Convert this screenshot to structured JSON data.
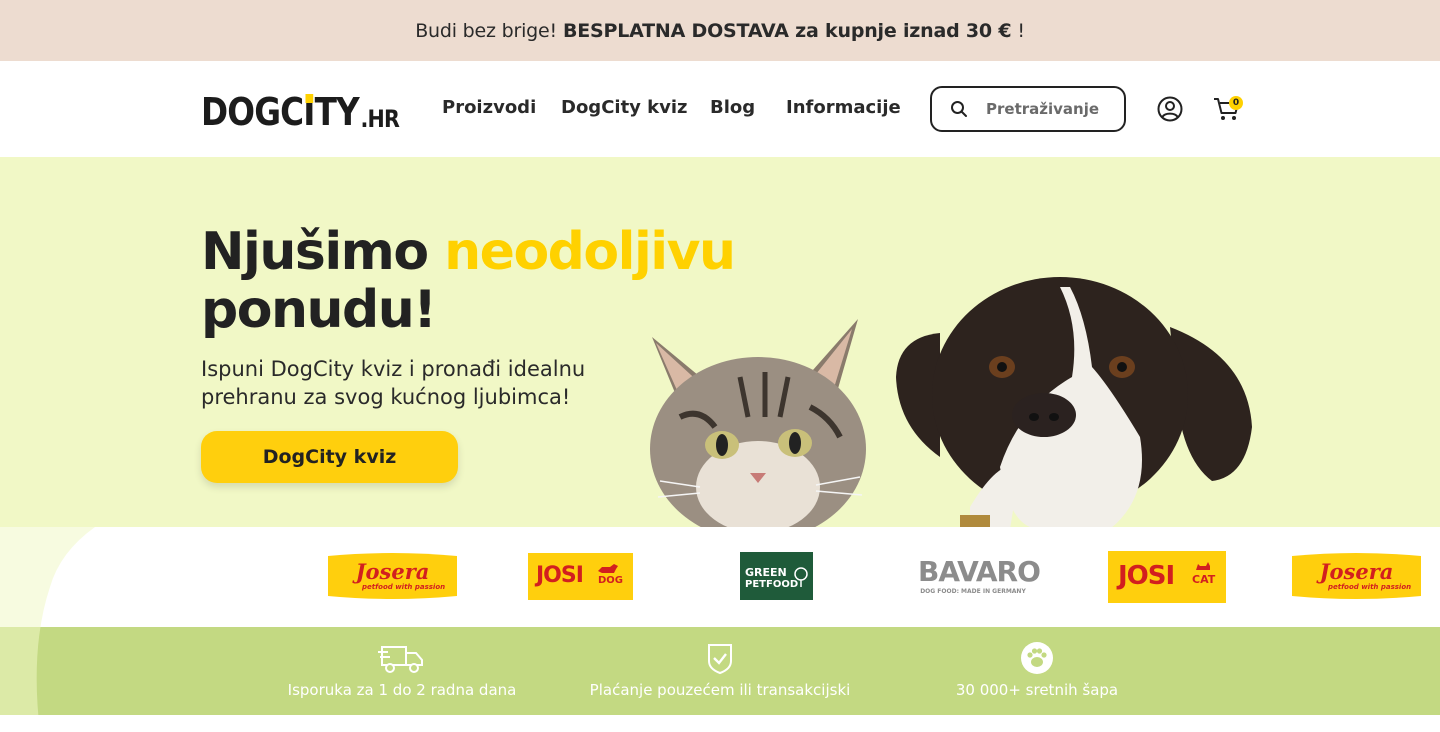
{
  "topbar": {
    "text": "Budi bez brige!",
    "bold": "BESPLATNA DOSTAVA za kupnje iznad 30 €",
    "tail": "!"
  },
  "header": {
    "logo": {
      "main_a": "DOGC",
      "main_i": "I",
      "main_b": "TY",
      "suffix": ".HR"
    },
    "nav": [
      "Proizvodi",
      "DogCity kviz",
      "Blog",
      "Informacije"
    ],
    "search": {
      "placeholder": "Pretraživanje",
      "value": ""
    },
    "cart_count": "0"
  },
  "hero": {
    "title_a": "Njušimo",
    "title_highlight": "neodoljivu",
    "title_b": "ponudu!",
    "subtitle": "Ispuni DogCity kviz i pronađi idealnu prehranu za svog kućnog ljubimca!",
    "cta": "DogCity kviz"
  },
  "brands": [
    {
      "name": "Josera",
      "tagline": "petfood with passion"
    },
    {
      "name": "JOSI",
      "tag": "DOG"
    },
    {
      "name_a": "GREEN",
      "name_b": "PETFOOD"
    },
    {
      "name": "BAVARO",
      "tagline": "DOG FOOD: MADE IN GERMANY"
    },
    {
      "name": "JOSI",
      "tag": "CAT"
    },
    {
      "name": "Josera",
      "tagline": "petfood with passion"
    }
  ],
  "benefits": [
    {
      "icon": "delivery-truck-icon",
      "text": "Isporuka za 1 do 2 radna dana"
    },
    {
      "icon": "shield-check-icon",
      "text": "Plaćanje pouzećem ili transakcijski"
    },
    {
      "icon": "paw-icon",
      "text": "30 000+ sretnih šapa"
    }
  ],
  "colors": {
    "accent": "#ffd100",
    "hero_bg": "#f1f8c6",
    "benefits_bg": "#c3d982",
    "topbar_bg": "#eddcd0"
  }
}
